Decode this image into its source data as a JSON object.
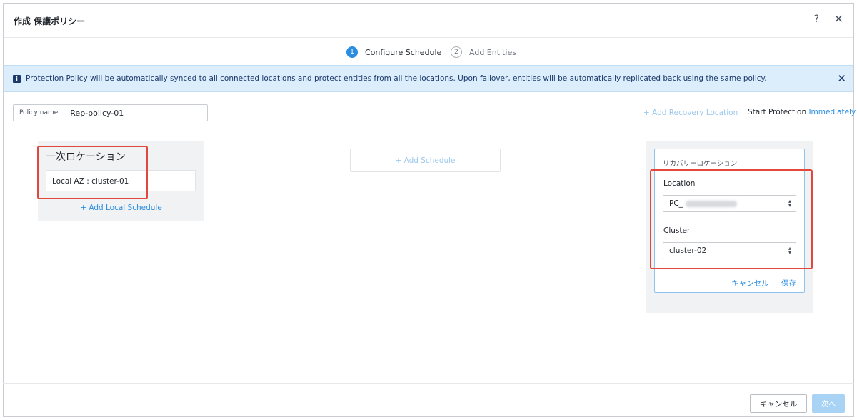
{
  "dialog": {
    "title": "作成 保護ポリシー",
    "help_glyph": "?",
    "close_glyph": "✕"
  },
  "steps": [
    {
      "number": "1",
      "label": "Configure Schedule",
      "state": "active"
    },
    {
      "number": "2",
      "label": "Add Entities",
      "state": "inactive"
    }
  ],
  "banner": {
    "icon": "info-icon",
    "icon_glyph": "i",
    "message": "Protection Policy will be automatically synced to all connected locations and protect entities from all the locations. Upon failover, entities will be automatically replicated back using the same policy.",
    "close_glyph": "✕"
  },
  "policy": {
    "name_label": "Policy name",
    "name_value": "Rep-policy-01"
  },
  "toolbar": {
    "add_recovery_location": "+ Add Recovery Location",
    "start_protection_label": "Start Protection",
    "start_protection_value": "Immediately"
  },
  "primary": {
    "title": "一次ロケーション",
    "location": "Local AZ : cluster-01",
    "add_local_schedule": "+  Add Local Schedule"
  },
  "schedule": {
    "add_schedule": "+ Add Schedule"
  },
  "recovery": {
    "title": "リカバリーロケーション",
    "location_label": "Location",
    "location_value": "PC_",
    "cluster_label": "Cluster",
    "cluster_value": "cluster-02",
    "cancel": "キャンセル",
    "save": "保存"
  },
  "footer": {
    "cancel": "キャンセル",
    "next": "次へ"
  },
  "colors": {
    "accent": "#2a8de0",
    "banner_bg": "#dcedfb",
    "highlight": "#e3463b"
  }
}
